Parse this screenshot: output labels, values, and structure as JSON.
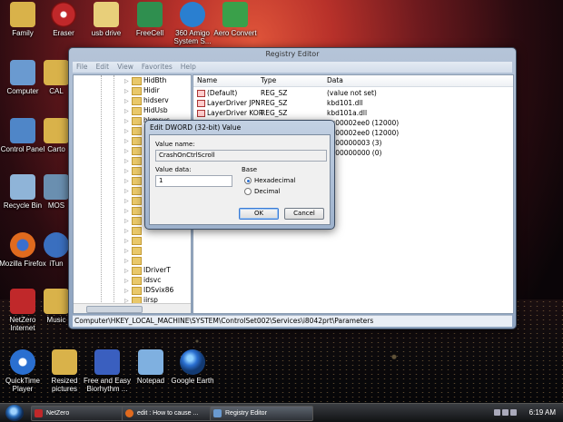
{
  "desktop": {
    "icons": [
      {
        "label": "Family",
        "color": "#d9b24a"
      },
      {
        "label": "Eraser",
        "color": "#c0282a"
      },
      {
        "label": "usb drive",
        "color": "#e8cf7a"
      },
      {
        "label": "FreeCell",
        "color": "#2f8f4f"
      },
      {
        "label": "360 Amigo System S...",
        "color": "#2a7fd0"
      },
      {
        "label": "Aero Convert",
        "color": "#3aa04a"
      },
      {
        "label": "Computer",
        "color": "#6a9ad0"
      },
      {
        "label": "CAL",
        "color": "#d9b24a"
      },
      {
        "label": "Control Panel",
        "color": "#4f86c8"
      },
      {
        "label": "Carto",
        "color": "#d9b24a"
      },
      {
        "label": "Recycle Bin",
        "color": "#8fb4d8"
      },
      {
        "label": "MOS",
        "color": "#6a8fb0"
      },
      {
        "label": "Mozilla Firefox",
        "color": "#e06a1e"
      },
      {
        "label": "iTun",
        "color": "#3a6fbf"
      },
      {
        "label": "NetZero Internet",
        "color": "#c0282a"
      },
      {
        "label": "Music",
        "color": "#d9b24a"
      },
      {
        "label": "QuickTime Player",
        "color": "#2a6fd0"
      },
      {
        "label": "Resized pictures",
        "color": "#d9b24a"
      },
      {
        "label": "Free and Easy Biorhythm ...",
        "color": "#3a5fbf"
      },
      {
        "label": "Notepad",
        "color": "#7fb0e0"
      },
      {
        "label": "Google Earth",
        "color": "#2a6fd0"
      }
    ]
  },
  "regedit": {
    "title": "Registry Editor",
    "menu": [
      "File",
      "Edit",
      "View",
      "Favorites",
      "Help"
    ],
    "tree_top": [
      "HidBth",
      "Hidir",
      "hidserv",
      "HidUsb",
      "hkmsvc"
    ],
    "tree_bottom": [
      "IDriverT",
      "idsvc",
      "IDSvix86",
      "iirsp",
      "IKEEXT",
      "inetaccs",
      "IntcAzAudA"
    ],
    "columns": {
      "name": "Name",
      "type": "Type",
      "data": "Data"
    },
    "values": [
      {
        "name": "(Default)",
        "type": "REG_SZ",
        "data": "(value not set)"
      },
      {
        "name": "LayerDriver JPN",
        "type": "REG_SZ",
        "data": "kbd101.dll"
      },
      {
        "name": "LayerDriver KOR",
        "type": "REG_SZ",
        "data": "kbd101a.dll"
      },
      {
        "name": "",
        "type": "",
        "data": "0x00002ee0 (12000)"
      },
      {
        "name": "",
        "type": "",
        "data": "0x00002ee0 (12000)"
      },
      {
        "name": "",
        "type": "",
        "data": "0x00000003 (3)"
      },
      {
        "name": "",
        "type": "",
        "data": "0x00000000 (0)"
      }
    ],
    "status_path": "Computer\\HKEY_LOCAL_MACHINE\\SYSTEM\\ControlSet002\\Services\\i8042prt\\Parameters"
  },
  "dialog": {
    "title": "Edit DWORD (32-bit) Value",
    "value_name_label": "Value name:",
    "value_name": "CrashOnCtrlScroll",
    "value_data_label": "Value data:",
    "value_data": "1",
    "base_label": "Base",
    "hex_label": "Hexadecimal",
    "dec_label": "Decimal",
    "base_selected": "Hexadecimal",
    "ok_label": "OK",
    "cancel_label": "Cancel"
  },
  "taskbar": {
    "tasks": [
      {
        "label": "NetZero",
        "color": "#c0282a"
      },
      {
        "label": "edit : How to cause ...",
        "color": "#e06a1e"
      },
      {
        "label": "Registry Editor",
        "color": "#6a9ad0"
      }
    ],
    "clock": "6:19 AM"
  }
}
